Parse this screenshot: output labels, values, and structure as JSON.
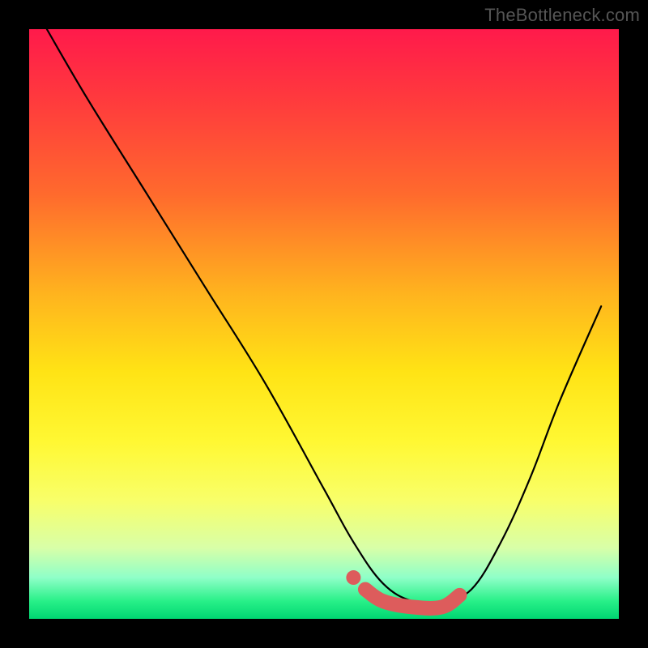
{
  "watermark": "TheBottleneck.com",
  "chart_data": {
    "type": "line",
    "title": "",
    "xlabel": "",
    "ylabel": "",
    "xlim": [
      0,
      100
    ],
    "ylim": [
      0,
      100
    ],
    "grid": false,
    "legend": false,
    "background_gradient": {
      "top": "#ff1a4b",
      "mid": "#ffe315",
      "bottom": "#00d672"
    },
    "series": [
      {
        "name": "bottleneck-curve",
        "color": "#000000",
        "x": [
          3,
          10,
          20,
          30,
          40,
          50,
          55,
          60,
          65,
          70,
          75,
          80,
          85,
          90,
          97
        ],
        "values": [
          100,
          88,
          72,
          56,
          40,
          22,
          13,
          6,
          3,
          3,
          5,
          13,
          24,
          37,
          53
        ]
      }
    ],
    "highlight": {
      "name": "optimal-range",
      "color": "#dd5c5c",
      "x": [
        57,
        60,
        65,
        70,
        73
      ],
      "values": [
        5,
        3,
        2,
        2,
        4
      ],
      "start_dot": {
        "x": 55,
        "y": 7
      }
    }
  },
  "colors": {
    "page_bg": "#000000",
    "watermark": "#555555",
    "curve": "#000000",
    "highlight": "#dd5c5c"
  }
}
